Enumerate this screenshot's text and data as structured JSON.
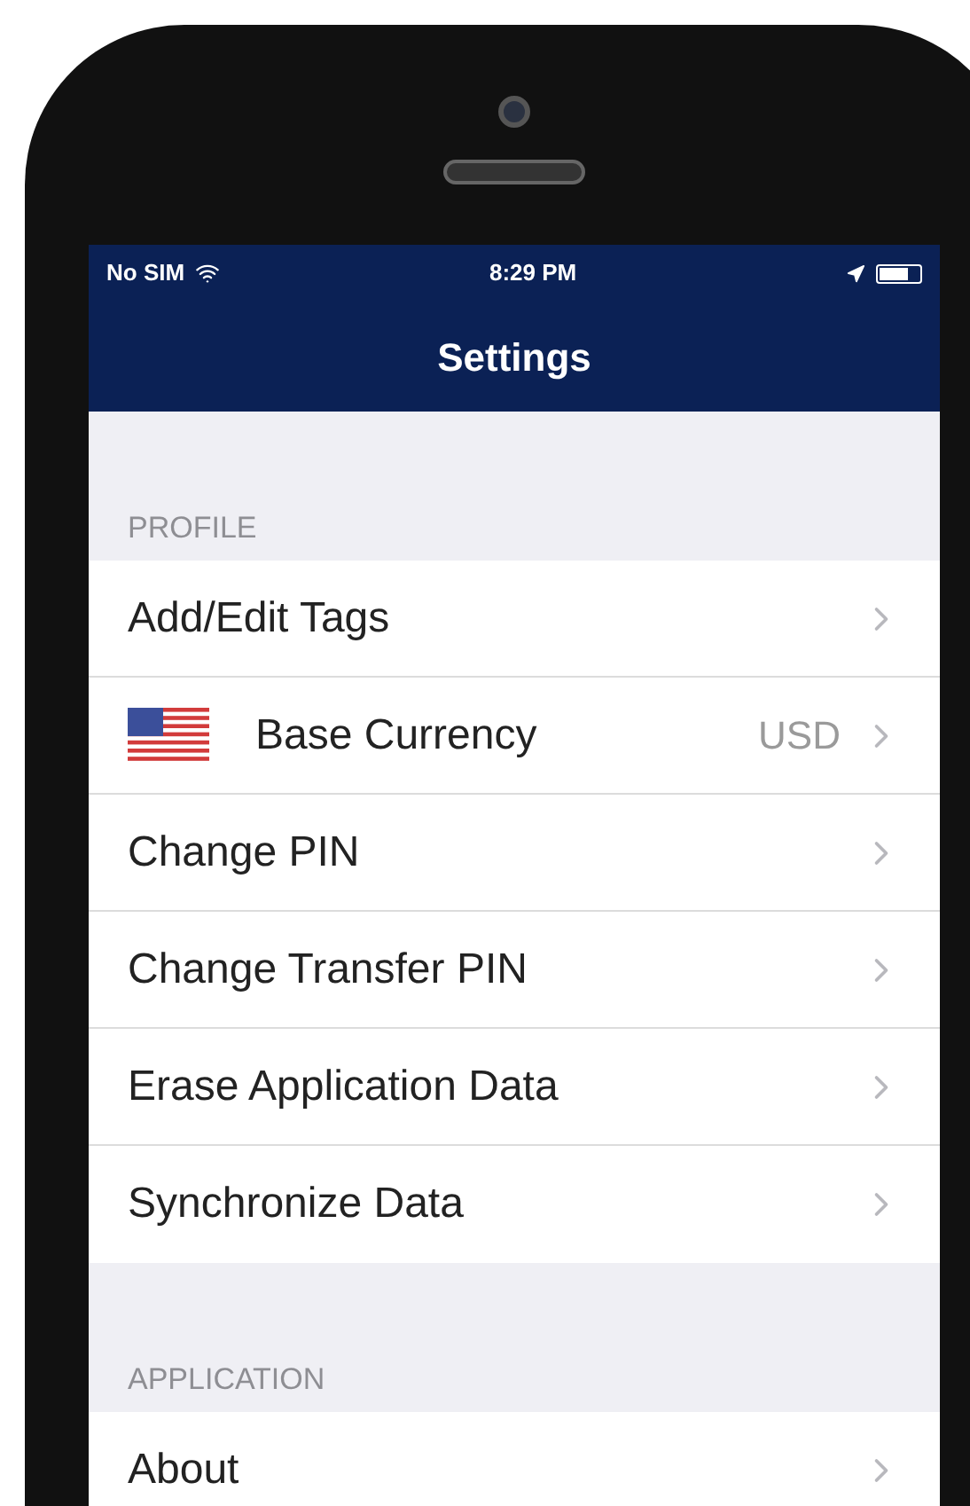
{
  "status_bar": {
    "carrier": "No SIM",
    "time": "8:29 PM"
  },
  "nav_bar": {
    "title": "Settings"
  },
  "sections": [
    {
      "header": "PROFILE",
      "items": [
        {
          "kind": "plain",
          "label": "Add/Edit Tags"
        },
        {
          "kind": "flag",
          "label": "Base Currency",
          "value": "USD"
        },
        {
          "kind": "plain",
          "label": "Change PIN"
        },
        {
          "kind": "plain",
          "label": "Change Transfer PIN"
        },
        {
          "kind": "plain",
          "label": "Erase Application Data"
        },
        {
          "kind": "plain",
          "label": "Synchronize Data"
        }
      ]
    },
    {
      "header": "APPLICATION",
      "items": [
        {
          "kind": "plain",
          "label": "About"
        }
      ]
    }
  ]
}
